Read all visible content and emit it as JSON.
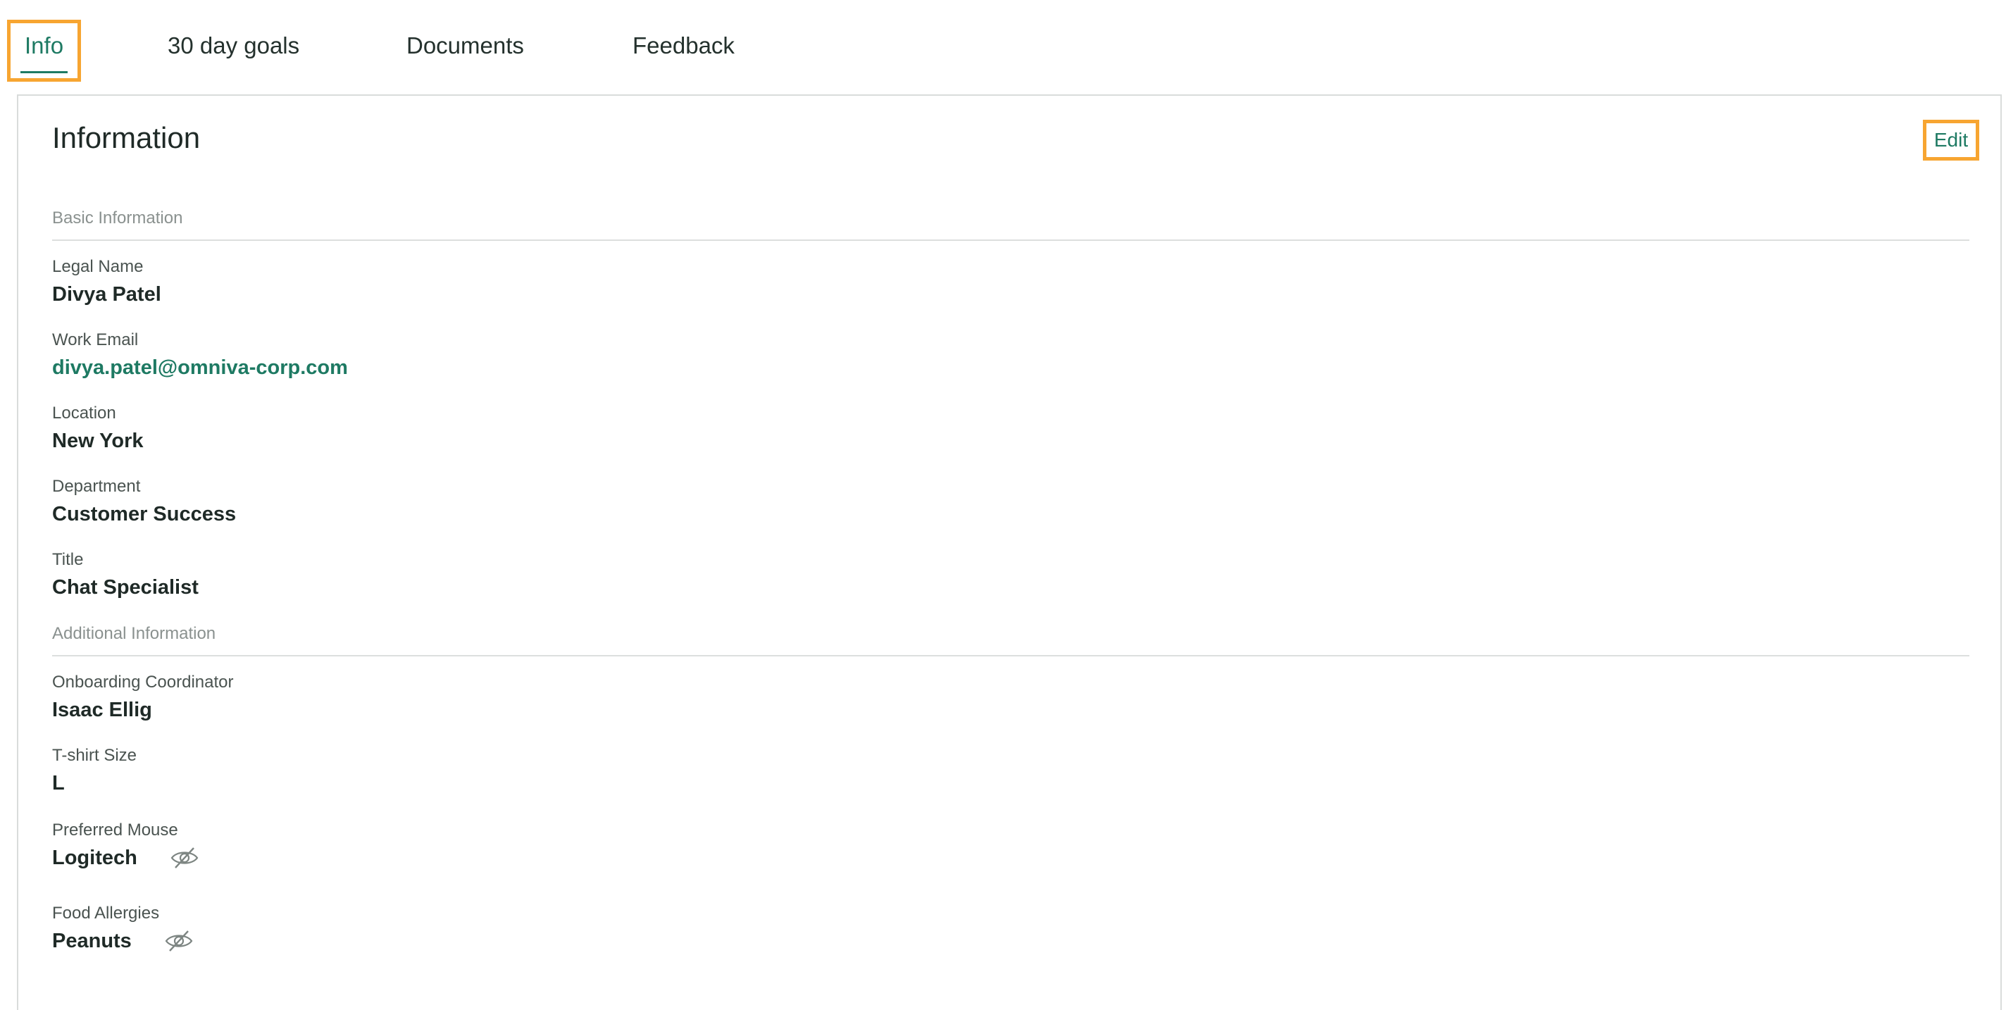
{
  "tabs": [
    {
      "label": "Info",
      "active": true
    },
    {
      "label": "30 day goals",
      "active": false
    },
    {
      "label": "Documents",
      "active": false
    },
    {
      "label": "Feedback",
      "active": false
    }
  ],
  "card": {
    "title": "Information",
    "edit_label": "Edit"
  },
  "sections": {
    "basic": "Basic Information",
    "additional": "Additional Information"
  },
  "fields": {
    "legal_name": {
      "label": "Legal Name",
      "value": "Divya Patel"
    },
    "work_email": {
      "label": "Work Email",
      "value": "divya.patel@omniva-corp.com"
    },
    "location": {
      "label": "Location",
      "value": "New York"
    },
    "department": {
      "label": "Department",
      "value": "Customer Success"
    },
    "title": {
      "label": "Title",
      "value": "Chat Specialist"
    },
    "onboarding_coordinator": {
      "label": "Onboarding Coordinator",
      "value": "Isaac Ellig"
    },
    "tshirt_size": {
      "label": "T-shirt Size",
      "value": "L"
    },
    "preferred_mouse": {
      "label": "Preferred Mouse",
      "value": "Logitech",
      "icon": "eye-slash-icon"
    },
    "food_allergies": {
      "label": "Food Allergies",
      "value": "Peanuts",
      "icon": "eye-slash-icon"
    }
  },
  "colors": {
    "accent": "#1e7a63",
    "highlight": "#f7a531",
    "text": "#1f2a27",
    "muted": "#8a918f"
  }
}
